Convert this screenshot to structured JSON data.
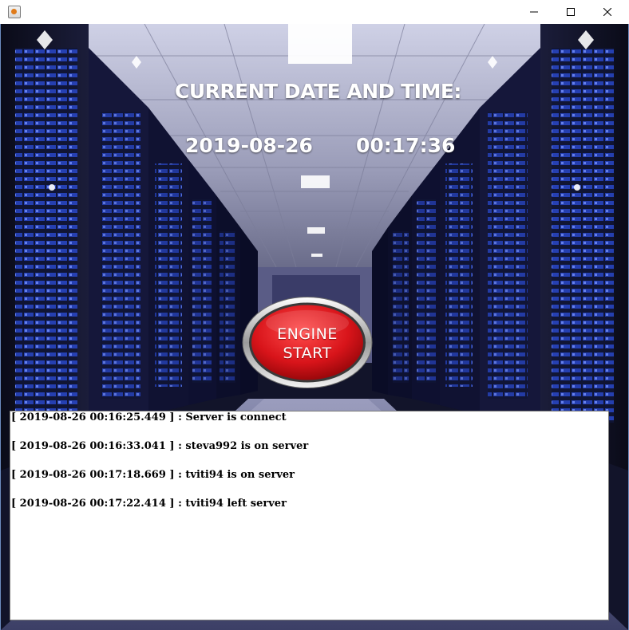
{
  "window": {
    "icon": "java-cup-icon",
    "controls": [
      "minimize-icon",
      "maximize-icon",
      "close-icon"
    ]
  },
  "header": {
    "title": "CURRENT DATE  AND TIME:",
    "date": "2019-08-26",
    "time": "00:17:36"
  },
  "engine_button": {
    "line1": "ENGINE",
    "line2": "START",
    "color": "#d8141a"
  },
  "log": {
    "entries": [
      "[ 2019-08-26 00:16:25.449 ] : Server is connect",
      "[ 2019-08-26 00:16:33.041 ] : steva992 is on server",
      "[ 2019-08-26 00:17:18.669 ] : tviti94 is on server",
      "[ 2019-08-26 00:17:22.414 ] : tviti94 left server"
    ]
  },
  "background": {
    "description_icon": "server-room-image",
    "accent": "#2c4dd8"
  }
}
